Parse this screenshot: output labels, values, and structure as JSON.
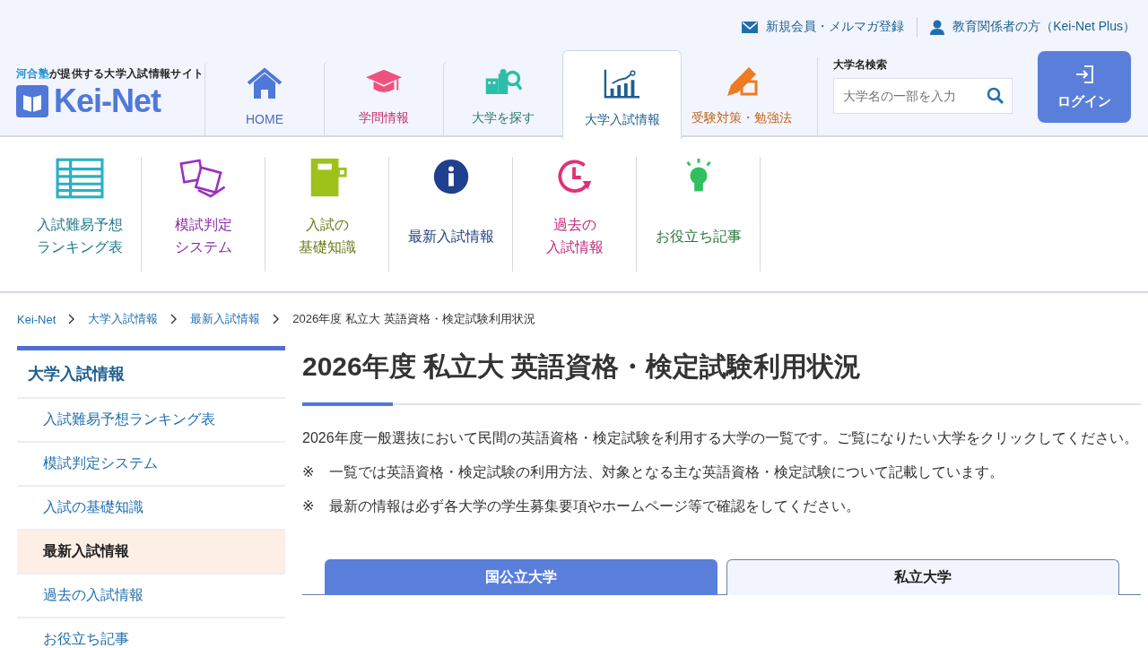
{
  "top_links": [
    {
      "kind": "mail",
      "label": "新規会員・メルマガ登録"
    },
    {
      "kind": "person",
      "label": "教育関係者の方（Kei-Net Plus）"
    }
  ],
  "logo": {
    "owner": "河合塾",
    "tagline": "が提供する大学入試情報サイト",
    "wordmark": "Kei-Net"
  },
  "nav_tabs": [
    {
      "label": "HOME",
      "color": "#4f6fbf",
      "selected": false
    },
    {
      "label": "学問情報",
      "color": "#c0306a",
      "selected": false
    },
    {
      "label": "大学を探す",
      "color": "#2a7a6a",
      "selected": false
    },
    {
      "label": "大学入試情報",
      "color": "#1f5f8f",
      "selected": true
    },
    {
      "label": "受験対策・勉強法",
      "color": "#c0661a",
      "selected": false
    }
  ],
  "search": {
    "label": "大学名検索",
    "placeholder": "大学名の一部を入力"
  },
  "login_button": "ログイン",
  "sub_menu": [
    {
      "lines": [
        "入試難易予想",
        "ランキング表"
      ],
      "color": "#1f7a8a"
    },
    {
      "lines": [
        "模試判定",
        "システム"
      ],
      "color": "#8a2aa8"
    },
    {
      "lines": [
        "入試の",
        "基礎知識"
      ],
      "color": "#6a7a1a"
    },
    {
      "lines": [
        "最新入試情報"
      ],
      "color": "#1f3f7f"
    },
    {
      "lines": [
        "過去の",
        "入試情報"
      ],
      "color": "#c02a7a"
    },
    {
      "lines": [
        "お役立ち記事"
      ],
      "color": "#2a7a3a"
    }
  ],
  "breadcrumb": [
    {
      "label": "Kei-Net",
      "current": false
    },
    {
      "label": "大学入試情報",
      "current": false
    },
    {
      "label": "最新入試情報",
      "current": false
    },
    {
      "label": "2026年度 私立大 英語資格・検定試験利用状況",
      "current": true
    }
  ],
  "sidebar": {
    "title": "大学入試情報",
    "items": [
      {
        "label": "入試難易予想ランキング表",
        "selected": false
      },
      {
        "label": "模試判定システム",
        "selected": false
      },
      {
        "label": "入試の基礎知識",
        "selected": false
      },
      {
        "label": "最新入試情報",
        "selected": true
      },
      {
        "label": "過去の入試情報",
        "selected": false
      },
      {
        "label": "お役立ち記事",
        "selected": false
      }
    ]
  },
  "page_title": "2026年度 私立大 英語資格・検定試験利用状況",
  "intro": "2026年度一般選抜において民間の英語資格・検定試験を利用する大学の一覧です。ご覧になりたい大学をクリックしてください。",
  "notes": [
    {
      "mark": "※",
      "text": "一覧では英語資格・検定試験の利用方法、対象となる主な英語資格・検定試験について記載しています。"
    },
    {
      "mark": "※",
      "text": "最新の情報は必ず各大学の学生募集要項やホームページ等で確認をしてください。"
    }
  ],
  "university_tabs": [
    {
      "label": "国公立大学",
      "selected": false
    },
    {
      "label": "私立大学",
      "selected": true
    }
  ]
}
